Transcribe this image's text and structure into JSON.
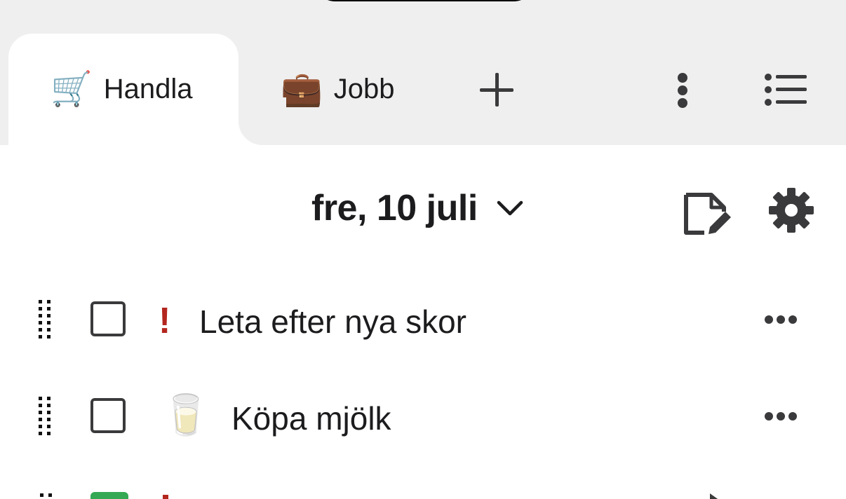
{
  "tabs": [
    {
      "emoji": "🛒",
      "label": "Handla",
      "active": true
    },
    {
      "emoji": "💼",
      "label": "Jobb",
      "active": false
    }
  ],
  "toolbar": {
    "add_icon": "plus-icon",
    "menu_icon": "vertical-ellipsis-icon",
    "lists_icon": "list-icon"
  },
  "header": {
    "date": "fre, 10 juli",
    "chevron_icon": "chevron-down-icon",
    "edit_icon": "edit-note-icon",
    "settings_icon": "gear-icon"
  },
  "items": [
    {
      "marker": "!",
      "marker_type": "priority",
      "text": "Leta efter nya skor",
      "checked": false
    },
    {
      "marker": "🥛",
      "marker_type": "emoji",
      "text": "Köpa mjölk",
      "checked": false
    }
  ],
  "colors": {
    "priority": "#b3261e",
    "checked": "#34a853",
    "tabbar_bg": "#efefef",
    "icon": "#3a3a3c"
  }
}
